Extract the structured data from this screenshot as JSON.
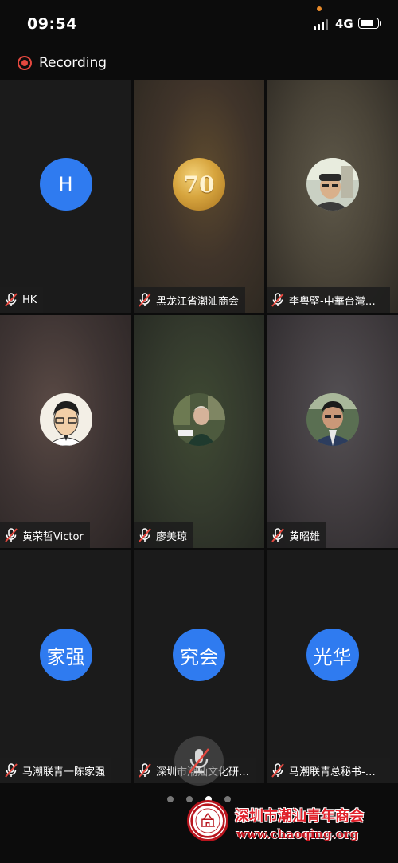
{
  "status_bar": {
    "time": "09:54",
    "network": "4G",
    "battery_fraction": 0.85
  },
  "recording": {
    "label": "Recording"
  },
  "tiles": [
    {
      "name": "HK",
      "avatar_type": "initials",
      "avatar_text": "H",
      "mic": "muted"
    },
    {
      "name": "黑龙江省潮汕商会",
      "avatar_type": "coin",
      "avatar_text": "70",
      "mic": "muted"
    },
    {
      "name": "李粤堅-中華台灣潮…",
      "avatar_type": "photo",
      "mic": "muted"
    },
    {
      "name": "黄荣哲Victor",
      "avatar_type": "illustration",
      "mic": "muted"
    },
    {
      "name": "廖美琼",
      "avatar_type": "photo",
      "mic": "muted"
    },
    {
      "name": "黄昭雄",
      "avatar_type": "photo",
      "mic": "muted"
    },
    {
      "name": "马潮联青一陈家强",
      "avatar_type": "initials",
      "avatar_text": "家强",
      "mic": "muted"
    },
    {
      "name": "深圳市潮汕文化研…",
      "avatar_type": "initials",
      "avatar_text": "究会",
      "mic": "muted"
    },
    {
      "name": "马潮联青总秘书-陈…",
      "avatar_type": "initials",
      "avatar_text": "光华",
      "mic": "muted"
    }
  ],
  "pager": {
    "pages": 4,
    "current": 3
  },
  "watermark": {
    "title": "深圳市潮汕青年商会",
    "url": "www.chaoqing.org"
  },
  "colors": {
    "avatar_blue": "#2f7bf0",
    "recording_red": "#e5483f",
    "mute_red": "#e5483f",
    "watermark_red": "#e0202a"
  }
}
